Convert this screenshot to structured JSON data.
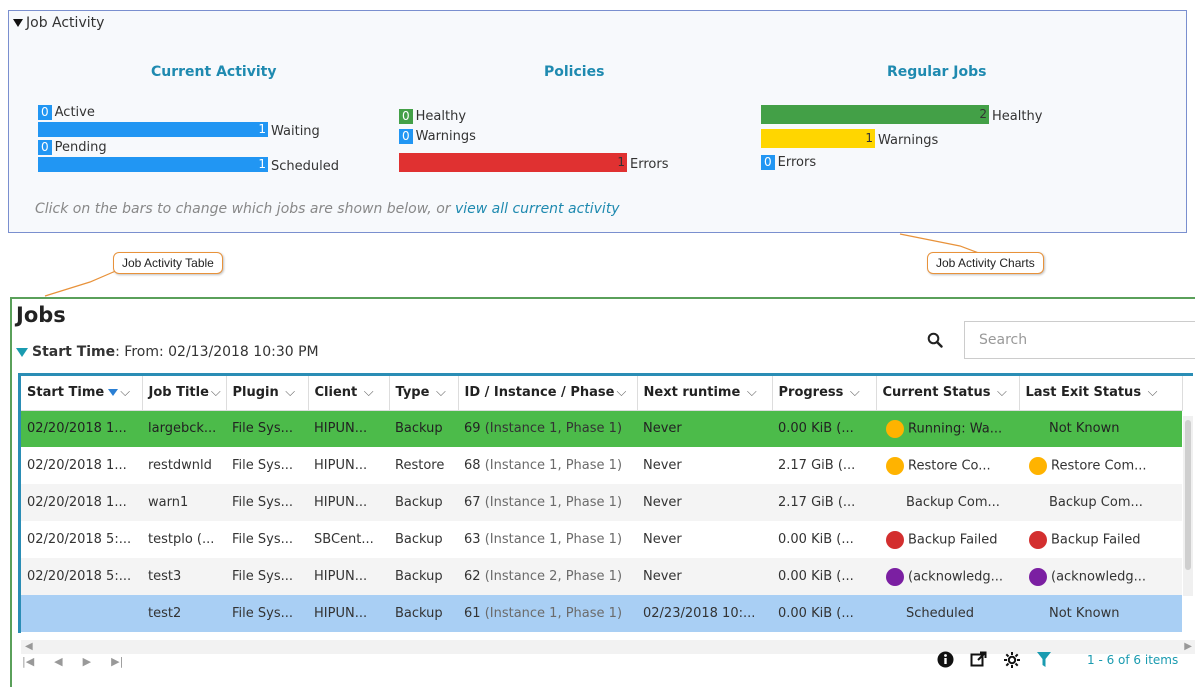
{
  "activity": {
    "header": "Job Activity",
    "current": {
      "title": "Current Activity",
      "active": {
        "count": "0",
        "label": "Active"
      },
      "waiting": {
        "count": "1",
        "label": "Waiting",
        "value": 1
      },
      "pending": {
        "count": "0",
        "label": "Pending"
      },
      "scheduled": {
        "count": "1",
        "label": "Scheduled",
        "value": 1
      }
    },
    "policies": {
      "title": "Policies",
      "healthy": {
        "count": "0",
        "label": "Healthy"
      },
      "warnings": {
        "count": "0",
        "label": "Warnings"
      },
      "errors": {
        "count": "1",
        "label": "Errors",
        "value": 1
      }
    },
    "regular": {
      "title": "Regular Jobs",
      "healthy": {
        "count": "2",
        "label": "Healthy",
        "value": 2
      },
      "warnings": {
        "count": "1",
        "label": "Warnings",
        "value": 1
      },
      "errors": {
        "count": "0",
        "label": "Errors"
      }
    },
    "hint_prefix": "Click on the bars to change which jobs are shown below, or",
    "hint_link": "view all current activity"
  },
  "callouts": {
    "table": "Job Activity Table",
    "charts": "Job Activity Charts"
  },
  "jobs": {
    "title": "Jobs",
    "filter_label": "Start Time",
    "filter_value": ": From: 02/13/2018 10:30 PM",
    "search_placeholder": "Search",
    "columns": [
      "Start Time",
      "Job Title",
      "Plugin",
      "Client",
      "Type",
      "ID / Instance / Phase",
      "Next runtime",
      "Progress",
      "Current Status",
      "Last Exit Status"
    ],
    "rows": [
      {
        "start": "02/20/2018 1...",
        "title": "largebck...",
        "plugin": "File Sys...",
        "client": "HIPUN...",
        "type": "Backup",
        "id": "69",
        "inst": "(Instance 1, Phase 1)",
        "next": "Never",
        "progress": "0.00 KiB (...",
        "current": "Running: Wa...",
        "current_dot": "orange",
        "last": "Not Known",
        "last_dot": ""
      },
      {
        "start": "02/20/2018 1...",
        "title": "restdwnld",
        "plugin": "File Sys...",
        "client": "HIPUN...",
        "type": "Restore",
        "id": "68",
        "inst": "(Instance 1, Phase 1)",
        "next": "Never",
        "progress": "2.17 GiB (...",
        "current": "Restore Co...",
        "current_dot": "orange",
        "last": "Restore Com...",
        "last_dot": "orange"
      },
      {
        "start": "02/20/2018 1...",
        "title": "warn1",
        "plugin": "File Sys...",
        "client": "HIPUN...",
        "type": "Backup",
        "id": "67",
        "inst": "(Instance 1, Phase 1)",
        "next": "Never",
        "progress": "2.17 GiB (...",
        "current": "Backup Com...",
        "current_dot": "",
        "last": "Backup Com...",
        "last_dot": ""
      },
      {
        "start": "02/20/2018 5:...",
        "title": "testplo (...",
        "plugin": "File Sys...",
        "client": "SBCent...",
        "type": "Backup",
        "id": "63",
        "inst": "(Instance 1, Phase 1)",
        "next": "Never",
        "progress": "0.00 KiB (...",
        "current": "Backup Failed",
        "current_dot": "red",
        "last": "Backup Failed",
        "last_dot": "red"
      },
      {
        "start": "02/20/2018 5:...",
        "title": "test3",
        "plugin": "File Sys...",
        "client": "HIPUN...",
        "type": "Backup",
        "id": "62",
        "inst": "(Instance 2, Phase 1)",
        "next": "Never",
        "progress": "0.00 KiB (...",
        "current": "(acknowledg...",
        "current_dot": "purple",
        "last": "(acknowledg...",
        "last_dot": "purple"
      },
      {
        "start": "",
        "title": "test2",
        "plugin": "File Sys...",
        "client": "HIPUN...",
        "type": "Backup",
        "id": "61",
        "inst": "(Instance 1, Phase 1)",
        "next": "02/23/2018 10:...",
        "progress": "0.00 KiB (...",
        "current": "Scheduled",
        "current_dot": "",
        "last": "Not Known",
        "last_dot": ""
      }
    ],
    "items_count": "1 - 6 of 6 items"
  }
}
